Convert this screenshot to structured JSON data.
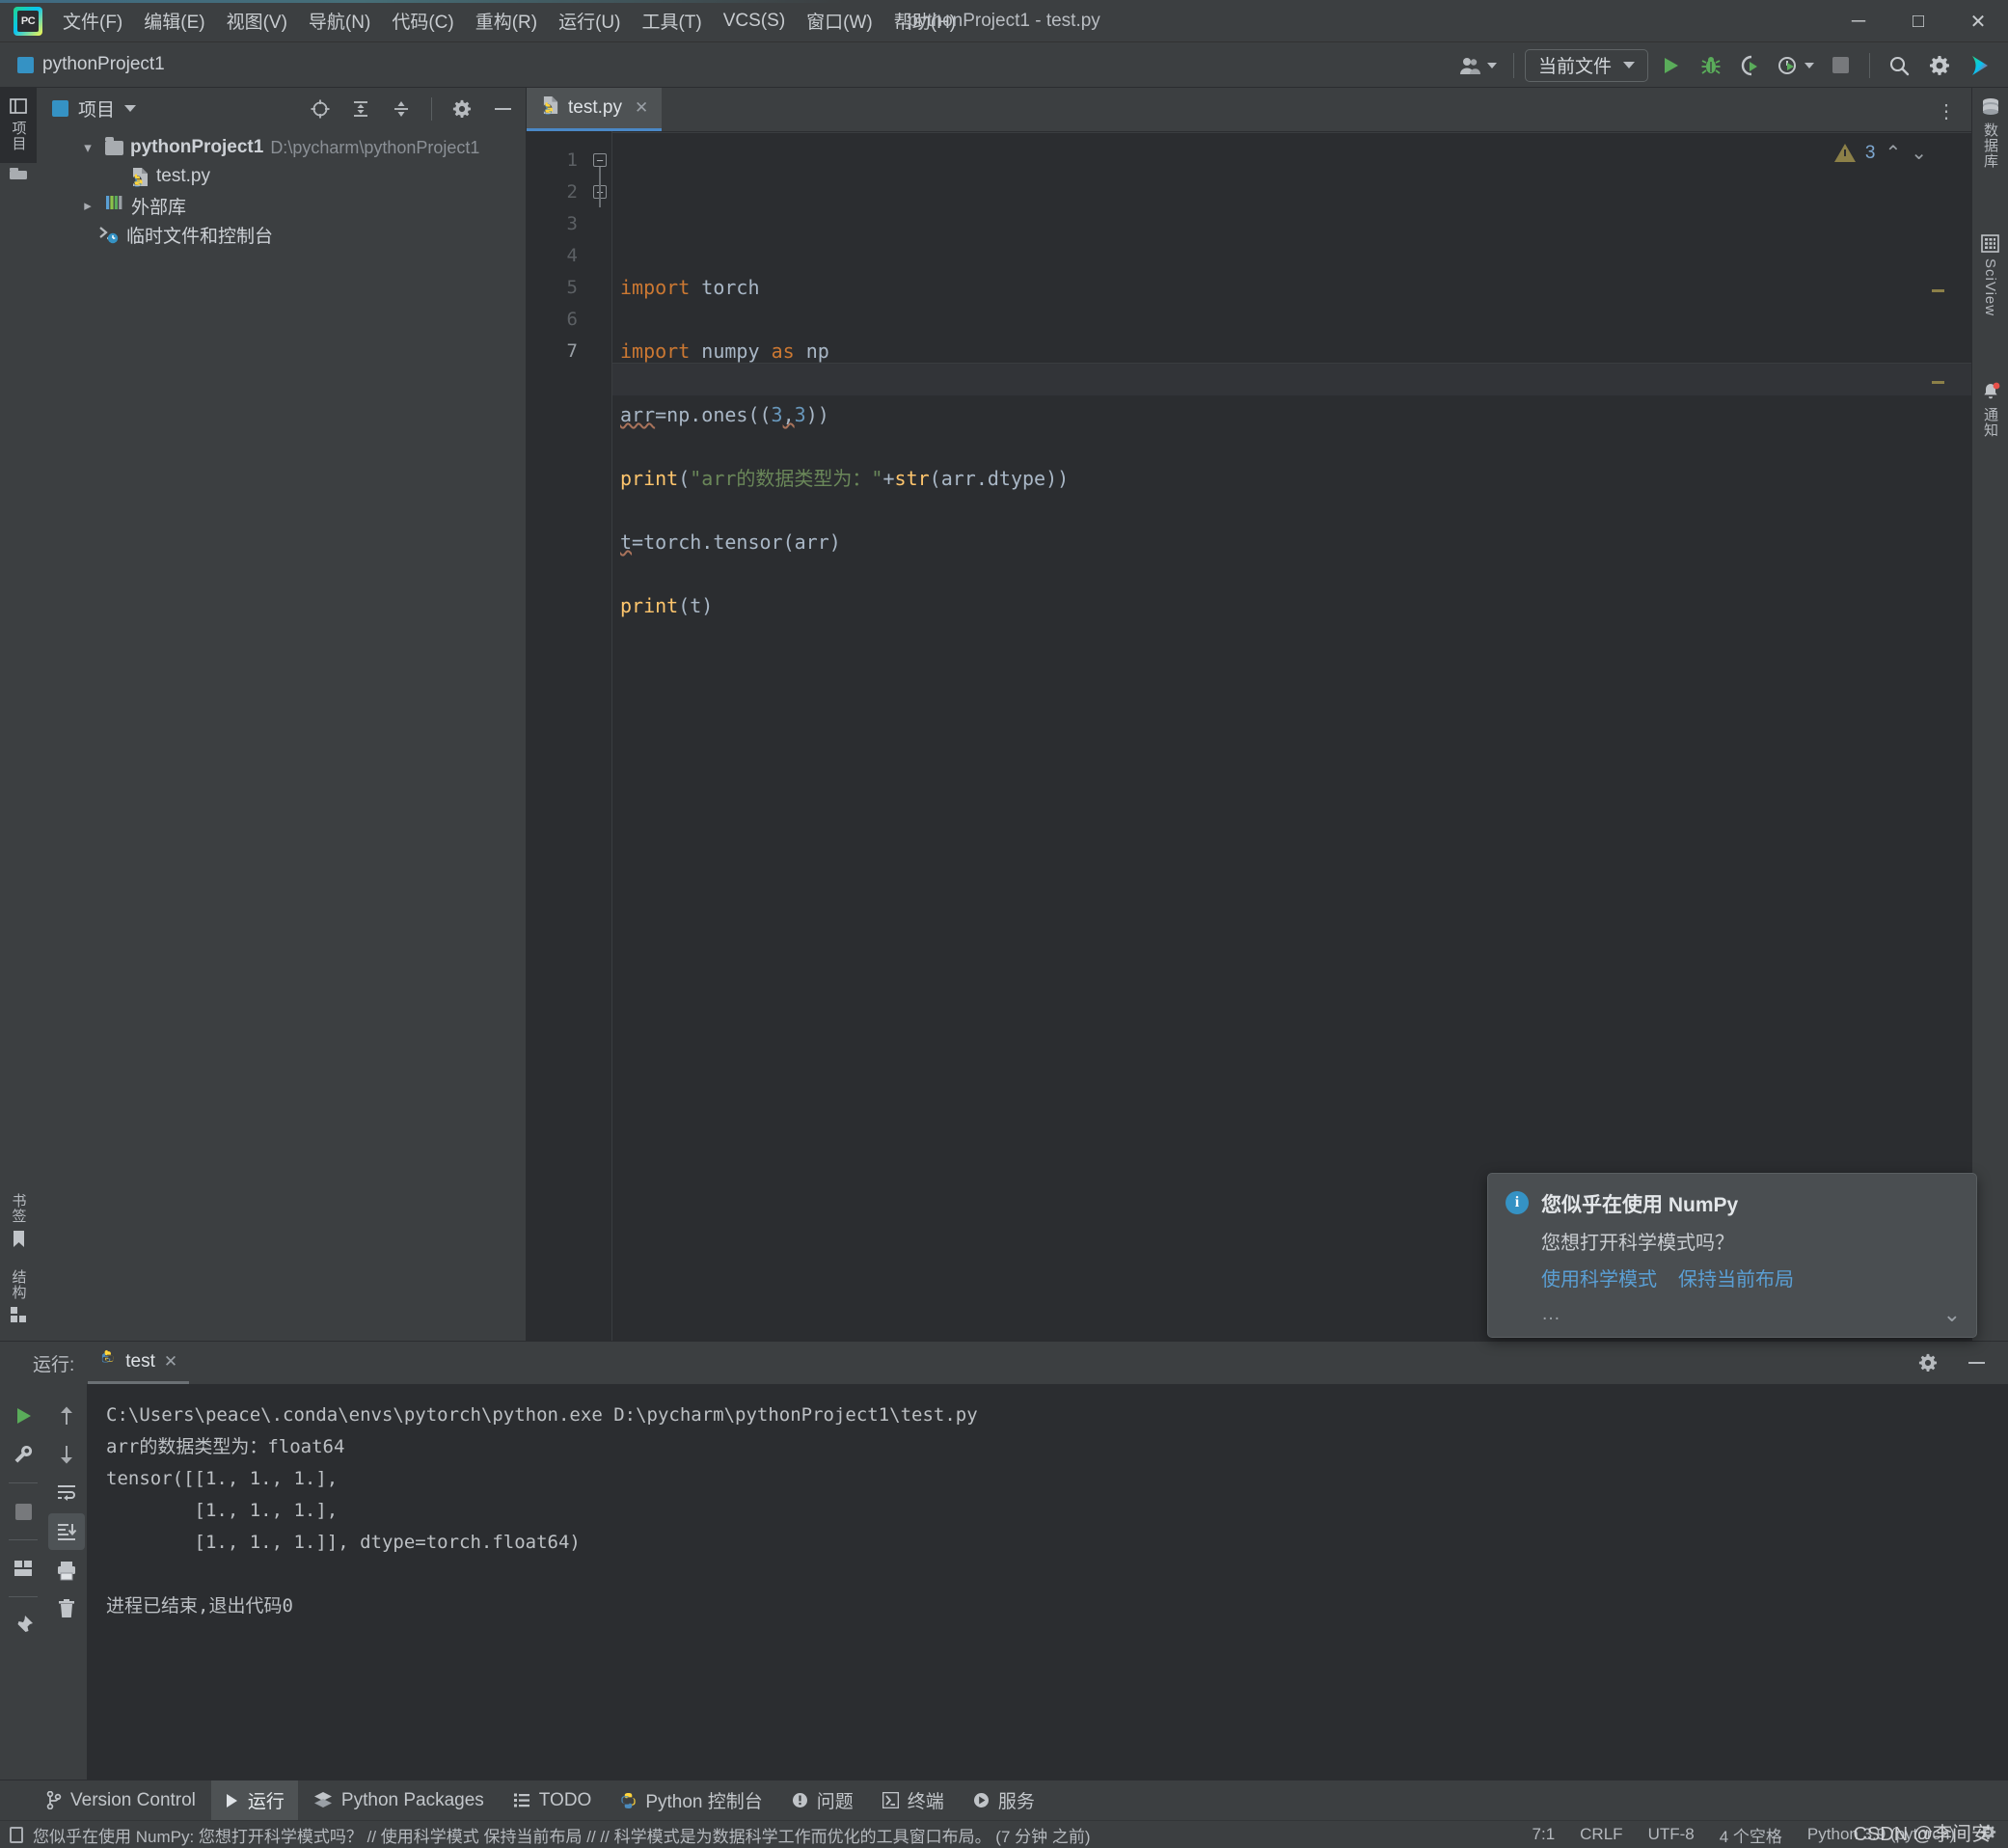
{
  "window": {
    "title": "pythonProject1 - test.py",
    "app_icon": "pycharm-logo-icon",
    "controls": {
      "minimize": "─",
      "maximize": "□",
      "close": "✕"
    }
  },
  "menubar": {
    "items": [
      {
        "label": "文件(F)"
      },
      {
        "label": "编辑(E)"
      },
      {
        "label": "视图(V)"
      },
      {
        "label": "导航(N)"
      },
      {
        "label": "代码(C)"
      },
      {
        "label": "重构(R)"
      },
      {
        "label": "运行(U)"
      },
      {
        "label": "工具(T)"
      },
      {
        "label": "VCS(S)"
      },
      {
        "label": "窗口(W)"
      },
      {
        "label": "帮助(H)"
      }
    ]
  },
  "toolbar": {
    "project_name": "pythonProject1",
    "run_config": "当前文件",
    "buttons": [
      {
        "name": "account-icon",
        "label": ""
      },
      {
        "name": "run-button",
        "label": ""
      },
      {
        "name": "debug-button",
        "label": ""
      },
      {
        "name": "run-coverage-button",
        "label": ""
      },
      {
        "name": "profile-button",
        "label": ""
      },
      {
        "name": "stop-button",
        "label": ""
      },
      {
        "name": "search-everywhere-button",
        "label": ""
      },
      {
        "name": "settings-button",
        "label": ""
      },
      {
        "name": "ai-assistant-button",
        "label": ""
      }
    ]
  },
  "left_strip": {
    "top": [
      {
        "name": "sidebar-item-project",
        "label": "项目",
        "active": true
      },
      {
        "name": "sidebar-item-commit",
        "label": ""
      }
    ],
    "bottom": [
      {
        "name": "sidebar-item-bookmarks",
        "label": "书签"
      },
      {
        "name": "sidebar-item-structure",
        "label": "结构"
      }
    ]
  },
  "right_strip": {
    "items": [
      {
        "name": "sidebar-item-database",
        "label": "数据库"
      },
      {
        "name": "sidebar-item-sciview",
        "label": "SciView"
      },
      {
        "name": "sidebar-item-notifications",
        "label": "通知"
      }
    ]
  },
  "project_panel": {
    "title": "项目",
    "header_buttons": [
      {
        "name": "select-opened-file-icon"
      },
      {
        "name": "expand-all-icon"
      },
      {
        "name": "collapse-all-icon"
      },
      {
        "name": "gear-icon"
      },
      {
        "name": "hide-icon"
      }
    ],
    "tree": [
      {
        "name": "tree-node-project-root",
        "label": "pythonProject1",
        "path": "D:\\pycharm\\pythonProject1",
        "icon": "folder-icon",
        "twist": "▾",
        "indent": 0,
        "bold": true
      },
      {
        "name": "tree-node-test-py",
        "label": "test.py",
        "path": "",
        "icon": "python-file-icon",
        "twist": "",
        "indent": 1,
        "bold": false
      },
      {
        "name": "tree-node-external-libraries",
        "label": "外部库",
        "path": "",
        "icon": "library-icon",
        "twist": "▸",
        "indent": 0,
        "bold": false
      },
      {
        "name": "tree-node-scratches",
        "label": "临时文件和控制台",
        "path": "",
        "icon": "scratches-icon",
        "twist": "",
        "indent": 0,
        "bold": false
      }
    ]
  },
  "editor": {
    "tab": {
      "label": "test.py",
      "icon": "python-file-icon",
      "close": "✕"
    },
    "inspection": {
      "icon": "warning-triangle-icon",
      "count": "3",
      "prev": "⌃",
      "next": "⌄"
    },
    "line_numbers": [
      "1",
      "2",
      "3",
      "4",
      "5",
      "6",
      "7"
    ],
    "code_lines": [
      "import torch",
      "import numpy as np",
      "arr=np.ones((3,3))",
      "print(\"arr的数据类型为：\"+str(arr.dtype))",
      "t=torch.tensor(arr)",
      "print(t)",
      ""
    ]
  },
  "run_window": {
    "label": "运行:",
    "tab": {
      "label": "test",
      "icon": "python-file-icon",
      "close": "✕"
    },
    "left_buttons": [
      {
        "name": "rerun-button"
      },
      {
        "name": "modify-run-config-button"
      },
      {
        "name": "stop-process-button"
      },
      {
        "name": "layout-button"
      },
      {
        "name": "pin-tab-button"
      }
    ],
    "right_buttons": [
      {
        "name": "up-stacktrace-button"
      },
      {
        "name": "down-stacktrace-button"
      },
      {
        "name": "soft-wrap-button"
      },
      {
        "name": "scroll-to-end-button"
      },
      {
        "name": "print-button"
      },
      {
        "name": "clear-all-button"
      }
    ],
    "header_buttons": [
      {
        "name": "gear-icon"
      },
      {
        "name": "hide-icon"
      }
    ],
    "console_lines": [
      "C:\\Users\\peace\\.conda\\envs\\pytorch\\python.exe D:\\pycharm\\pythonProject1\\test.py",
      "arr的数据类型为：float64",
      "tensor([[1., 1., 1.],",
      "        [1., 1., 1.],",
      "        [1., 1., 1.]], dtype=torch.float64)",
      "",
      "进程已结束,退出代码0"
    ]
  },
  "balloon": {
    "icon": "info-icon",
    "title": "您似乎在使用 NumPy",
    "text": "您想打开科学模式吗？",
    "link_primary": "使用科学模式",
    "link_secondary": "保持当前布局",
    "more": "…",
    "collapse": "⌄"
  },
  "bottom_bar": {
    "items": [
      {
        "name": "tool-window-version-control",
        "label": "Version Control",
        "icon": "branch-icon",
        "active": false
      },
      {
        "name": "tool-window-run",
        "label": "运行",
        "icon": "run-icon",
        "active": true
      },
      {
        "name": "tool-window-python-packages",
        "label": "Python Packages",
        "icon": "packages-icon",
        "active": false
      },
      {
        "name": "tool-window-todo",
        "label": "TODO",
        "icon": "todo-icon",
        "active": false
      },
      {
        "name": "tool-window-python-console",
        "label": "Python 控制台",
        "icon": "python-icon",
        "active": false
      },
      {
        "name": "tool-window-problems",
        "label": "问题",
        "icon": "problems-icon",
        "active": false
      },
      {
        "name": "tool-window-terminal",
        "label": "终端",
        "icon": "terminal-icon",
        "active": false
      },
      {
        "name": "tool-window-services",
        "label": "服务",
        "icon": "services-icon",
        "active": false
      }
    ]
  },
  "status_bar": {
    "message": "您似乎在使用 NumPy: 您想打开科学模式吗？  // 使用科学模式   保持当前布局 // // 科学模式是为数据科学工作而优化的工具窗口布局。 (7 分钟 之前)",
    "caret_position": "7:1",
    "line_separator": "CRLF",
    "encoding": "UTF-8",
    "indent": "4 个空格",
    "interpreter": "Python 3.9 (pytorch)",
    "watermark": "CSDN @李间安"
  },
  "colors": {
    "accent_blue": "#4a88c7",
    "run_green": "#5aac5a",
    "warning": "#8c8048",
    "link": "#5a9fd4",
    "bg_dark": "#2b2d30",
    "bg_panel": "#3c3f41"
  }
}
